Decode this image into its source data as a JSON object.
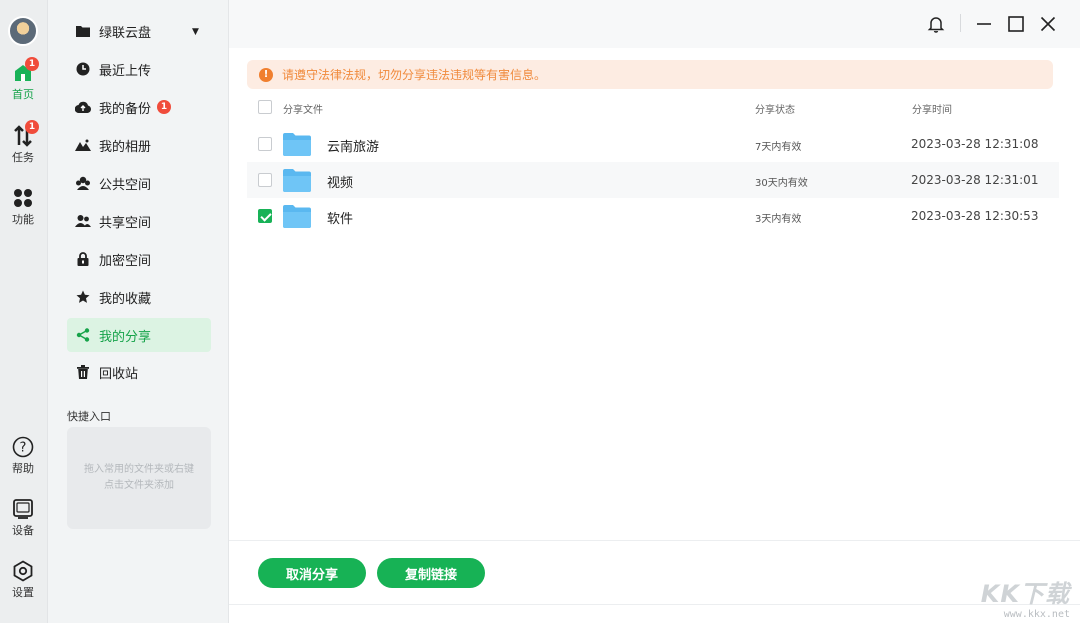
{
  "rail": {
    "items": [
      {
        "label": "首页",
        "badge": "1"
      },
      {
        "label": "任务",
        "badge": "1"
      },
      {
        "label": "功能"
      },
      {
        "label": "帮助"
      },
      {
        "label": "设备"
      },
      {
        "label": "设置"
      }
    ]
  },
  "nav": {
    "items": [
      {
        "label": "绿联云盘",
        "icon": "folder-icon"
      },
      {
        "label": "最近上传",
        "icon": "clock-icon"
      },
      {
        "label": "我的备份",
        "icon": "cloud-upload-icon",
        "badge": "1"
      },
      {
        "label": "我的相册",
        "icon": "mountain-icon"
      },
      {
        "label": "公共空间",
        "icon": "users-icon"
      },
      {
        "label": "共享空间",
        "icon": "people-icon"
      },
      {
        "label": "加密空间",
        "icon": "lock-icon"
      },
      {
        "label": "我的收藏",
        "icon": "star-icon"
      },
      {
        "label": "我的分享",
        "icon": "share-icon"
      },
      {
        "label": "回收站",
        "icon": "trash-icon"
      }
    ],
    "quick_title": "快捷入口",
    "quick_hint": "拖入常用的文件夹或右键点击文件夹添加"
  },
  "notice": "请遵守法律法规，切勿分享违法违规等有害信息。",
  "table": {
    "headers": [
      "分享文件",
      "分享状态",
      "分享时间"
    ],
    "rows": [
      {
        "name": "云南旅游",
        "status": "7天内有效",
        "time": "2023-03-28 12:31:08",
        "checked": false
      },
      {
        "name": "视频",
        "status": "30天内有效",
        "time": "2023-03-28 12:31:01",
        "checked": false
      },
      {
        "name": "软件",
        "status": "3天内有效",
        "time": "2023-03-28 12:30:53",
        "checked": true
      }
    ]
  },
  "footer": {
    "cancel_label": "取消分享",
    "copy_label": "复制链接"
  },
  "watermark": {
    "logo": "KK下载",
    "url": "www.kkx.net"
  },
  "colors": {
    "accent": "#17b255",
    "warning": "#f07f2e",
    "badge": "#f04c3b"
  }
}
